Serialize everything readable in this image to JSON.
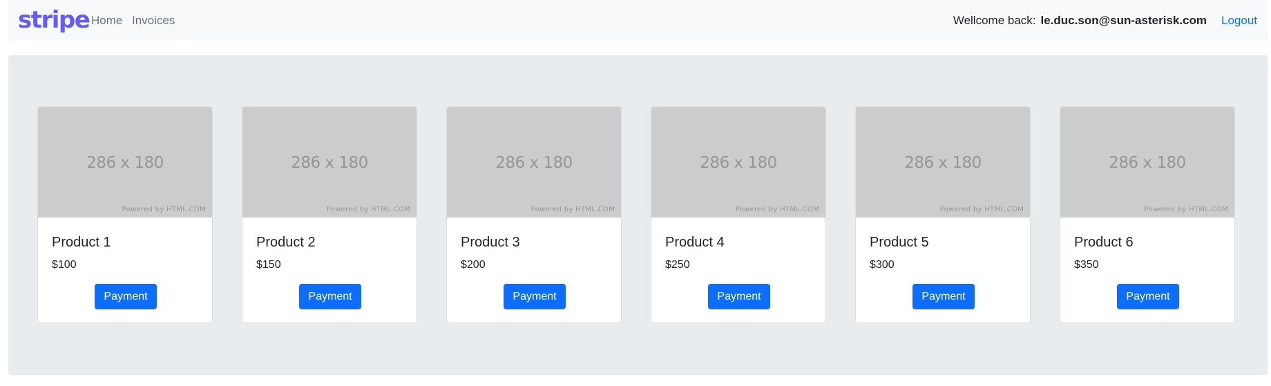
{
  "navbar": {
    "brand": "stripe",
    "links": [
      "Home",
      "Invoices"
    ],
    "welcome_label": "Wellcome back:",
    "user_email": "le.duc.son@sun-asterisk.com",
    "logout_label": "Logout"
  },
  "products": [
    {
      "image_dim": "286 x 180",
      "image_credit": "Powered by HTML.COM",
      "name": "Product 1",
      "price": "$100",
      "button": "Payment"
    },
    {
      "image_dim": "286 x 180",
      "image_credit": "Powered by HTML.COM",
      "name": "Product 2",
      "price": "$150",
      "button": "Payment"
    },
    {
      "image_dim": "286 x 180",
      "image_credit": "Powered by HTML.COM",
      "name": "Product 3",
      "price": "$200",
      "button": "Payment"
    },
    {
      "image_dim": "286 x 180",
      "image_credit": "Powered by HTML.COM",
      "name": "Product 4",
      "price": "$250",
      "button": "Payment"
    },
    {
      "image_dim": "286 x 180",
      "image_credit": "Powered by HTML.COM",
      "name": "Product 5",
      "price": "$300",
      "button": "Payment"
    },
    {
      "image_dim": "286 x 180",
      "image_credit": "Powered by HTML.COM",
      "name": "Product 6",
      "price": "$350",
      "button": "Payment"
    }
  ],
  "colors": {
    "brand": "#635bff",
    "primary_button": "#0d6efd",
    "navbar_bg": "#f8f9fa",
    "main_bg": "#e9ecef",
    "placeholder_bg": "#cccccc"
  }
}
